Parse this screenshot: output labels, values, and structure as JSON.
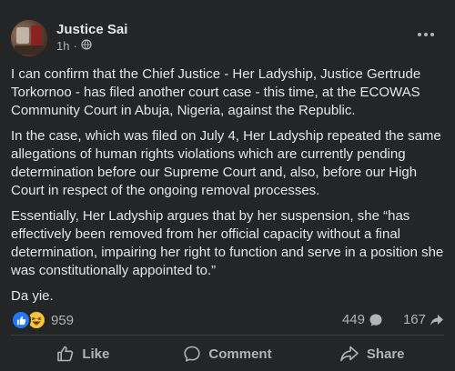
{
  "post": {
    "author": "Justice Sai",
    "time": "1h",
    "audience_icon": "globe-icon",
    "paragraphs": [
      "I can confirm that the Chief Justice - Her Ladyship, Justice Gertrude Torkornoo - has filed another court case - this time, at the ECOWAS Community Court in Abuja, Nigeria, against the Republic.",
      "In the case, which was filed on July 4, Her Ladyship repeated the same allegations of human rights violations which are currently pending determination before our Supreme Court and, also, before our High Court in respect of the ongoing removal processes.",
      "Essentially, Her Ladyship argues that by her suspension, she “has effectively been removed from her official capacity without a final determination, impairing her right to function and serve in a position she was constitutionally appointed to.”",
      "Da yie."
    ]
  },
  "engagement": {
    "reaction_count": "959",
    "comment_count": "449",
    "share_count": "167",
    "reaction_icons": [
      "like-icon",
      "haha-icon"
    ]
  },
  "actions": {
    "like_label": "Like",
    "comment_label": "Comment",
    "share_label": "Share"
  },
  "colors": {
    "background": "#242526",
    "text": "#e4e6eb",
    "secondary_text": "#b0b3b8",
    "like_blue": "#2078f4",
    "haha_yellow": "#f7c33b"
  }
}
